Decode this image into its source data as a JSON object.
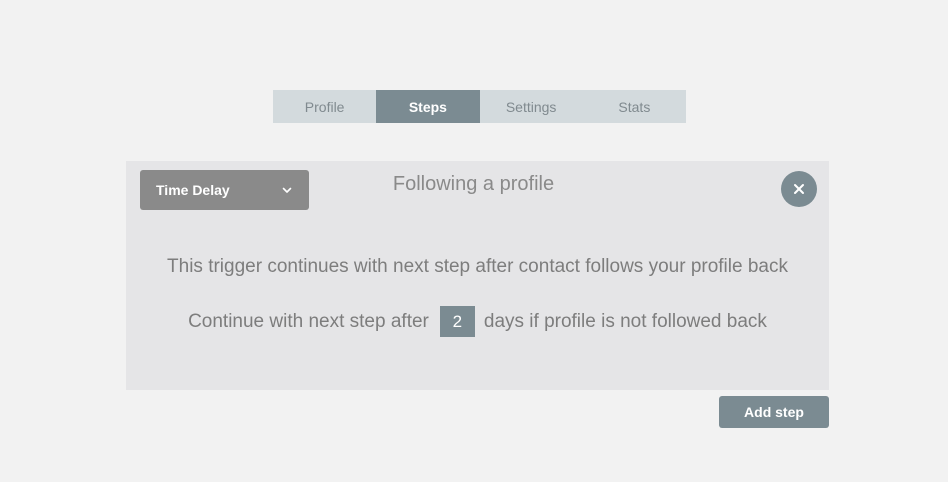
{
  "tabs": [
    {
      "label": "Profile",
      "active": false
    },
    {
      "label": "Steps",
      "active": true
    },
    {
      "label": "Settings",
      "active": false
    },
    {
      "label": "Stats",
      "active": false
    }
  ],
  "step": {
    "type_selected": "Time Delay",
    "title": "Following a profile",
    "description": "This trigger continues with next step after contact follows your profile back",
    "delay_prefix": "Continue with next step after",
    "delay_days": "2",
    "delay_suffix": "days if profile is not followed back"
  },
  "actions": {
    "add_step_label": "Add step"
  },
  "icons": {
    "dropdown": "chevron-down-icon",
    "close": "close-icon"
  },
  "colors": {
    "accent": "#7b8b92",
    "tab_inactive_bg": "#d3dadd",
    "panel_bg": "#e5e5e7",
    "dropdown_bg": "#8a8a8a",
    "page_bg": "#f2f2f2"
  }
}
